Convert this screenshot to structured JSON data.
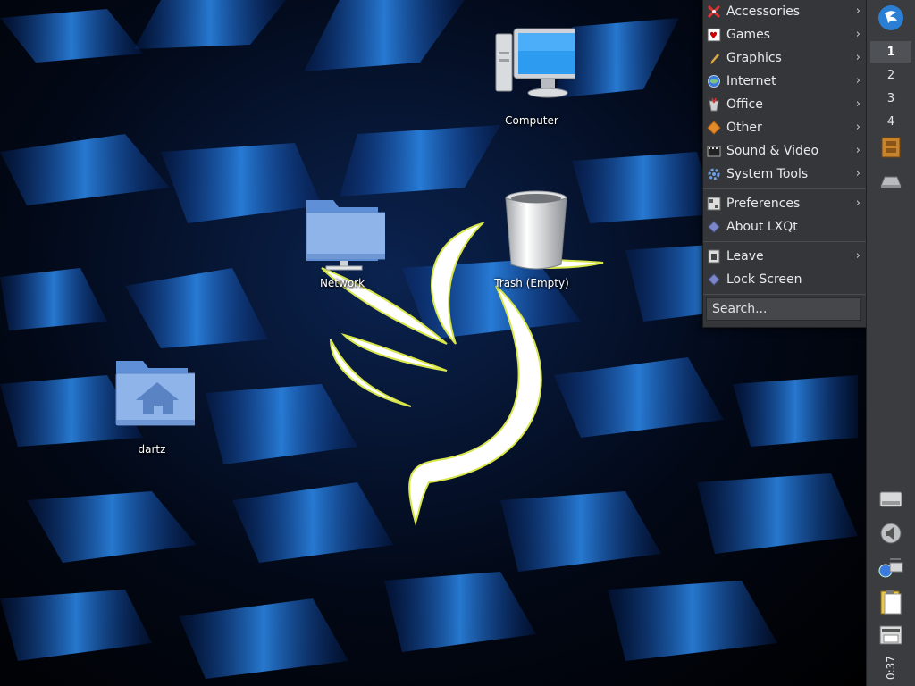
{
  "desktop": {
    "icons": {
      "computer": "Computer",
      "network": "Network",
      "trash": "Trash (Empty)",
      "home": "dartz"
    }
  },
  "menu": {
    "categories": [
      {
        "label": "Accessories",
        "icon": "accessories-icon"
      },
      {
        "label": "Games",
        "icon": "games-icon"
      },
      {
        "label": "Graphics",
        "icon": "graphics-icon"
      },
      {
        "label": "Internet",
        "icon": "internet-icon"
      },
      {
        "label": "Office",
        "icon": "office-icon"
      },
      {
        "label": "Other",
        "icon": "other-icon"
      },
      {
        "label": "Sound & Video",
        "icon": "sound-video-icon"
      },
      {
        "label": "System Tools",
        "icon": "system-tools-icon"
      }
    ],
    "preferences": "Preferences",
    "about": "About LXQt",
    "leave": "Leave",
    "lock_screen": "Lock Screen",
    "search_placeholder": "Search...",
    "submenu_chevron": "›"
  },
  "panel": {
    "workspaces": [
      "1",
      "2",
      "3",
      "4"
    ],
    "active_workspace": "1",
    "clock": "0:37",
    "tray_icons": [
      "drive-icon",
      "speaker-icon",
      "network-tray-icon",
      "clipboard-icon",
      "keyboard-icon"
    ]
  },
  "colors": {
    "panel_bg": "#3a3c40",
    "menu_bg": "#34363a",
    "wallpaper_accent": "#1a6fe0"
  }
}
